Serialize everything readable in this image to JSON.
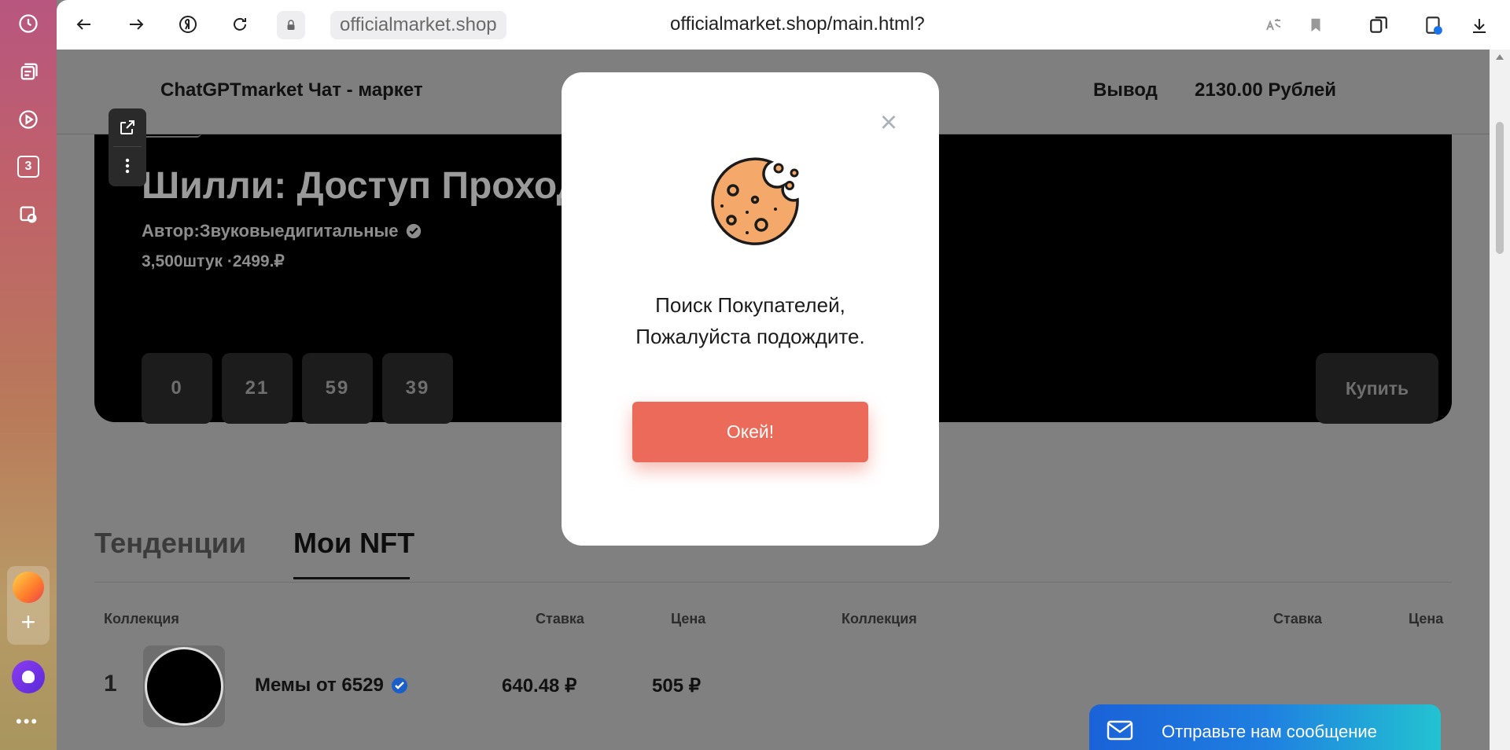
{
  "browser": {
    "url_host": "officialmarket.shop",
    "url_full": "officialmarket.shop/main.html?",
    "sidebar_badge": "3"
  },
  "header": {
    "brand": "ChatGPTmarket Чат - маркет",
    "withdraw": "Вывод",
    "balance": "2130.00 Рублей"
  },
  "hero": {
    "title": "Шилли: Доступ Проход",
    "author": "Автор:Звуковыедигитальные",
    "meta": "3,500штук ·2499.₽",
    "timer": [
      "0",
      "21",
      "59",
      "39"
    ],
    "buy_label": "Купить"
  },
  "tabs": {
    "trends": "Тенденции",
    "mine": "Мои NFT"
  },
  "table": {
    "columns_left": [
      "Коллекция",
      "Ставка",
      "Цена"
    ],
    "columns_right": [
      "Коллекция",
      "Ставка",
      "Цена"
    ],
    "rows": [
      {
        "num": "1",
        "name": "Мемы от 6529",
        "rate": "640.48 ₽",
        "price": "505 ₽"
      }
    ]
  },
  "chat": {
    "label": "Отправьте нам сообщение"
  },
  "modal": {
    "text_line1": "Поиск Покупателей,",
    "text_line2": "Пожалуйста подождите.",
    "ok_label": "Окей!",
    "close_symbol": "×"
  },
  "colors": {
    "accent_button": "#ec6a59",
    "chat_gradient_start": "#1a62d8",
    "chat_gradient_end": "#22c3d1",
    "cookie_fill": "#f4a96a"
  }
}
